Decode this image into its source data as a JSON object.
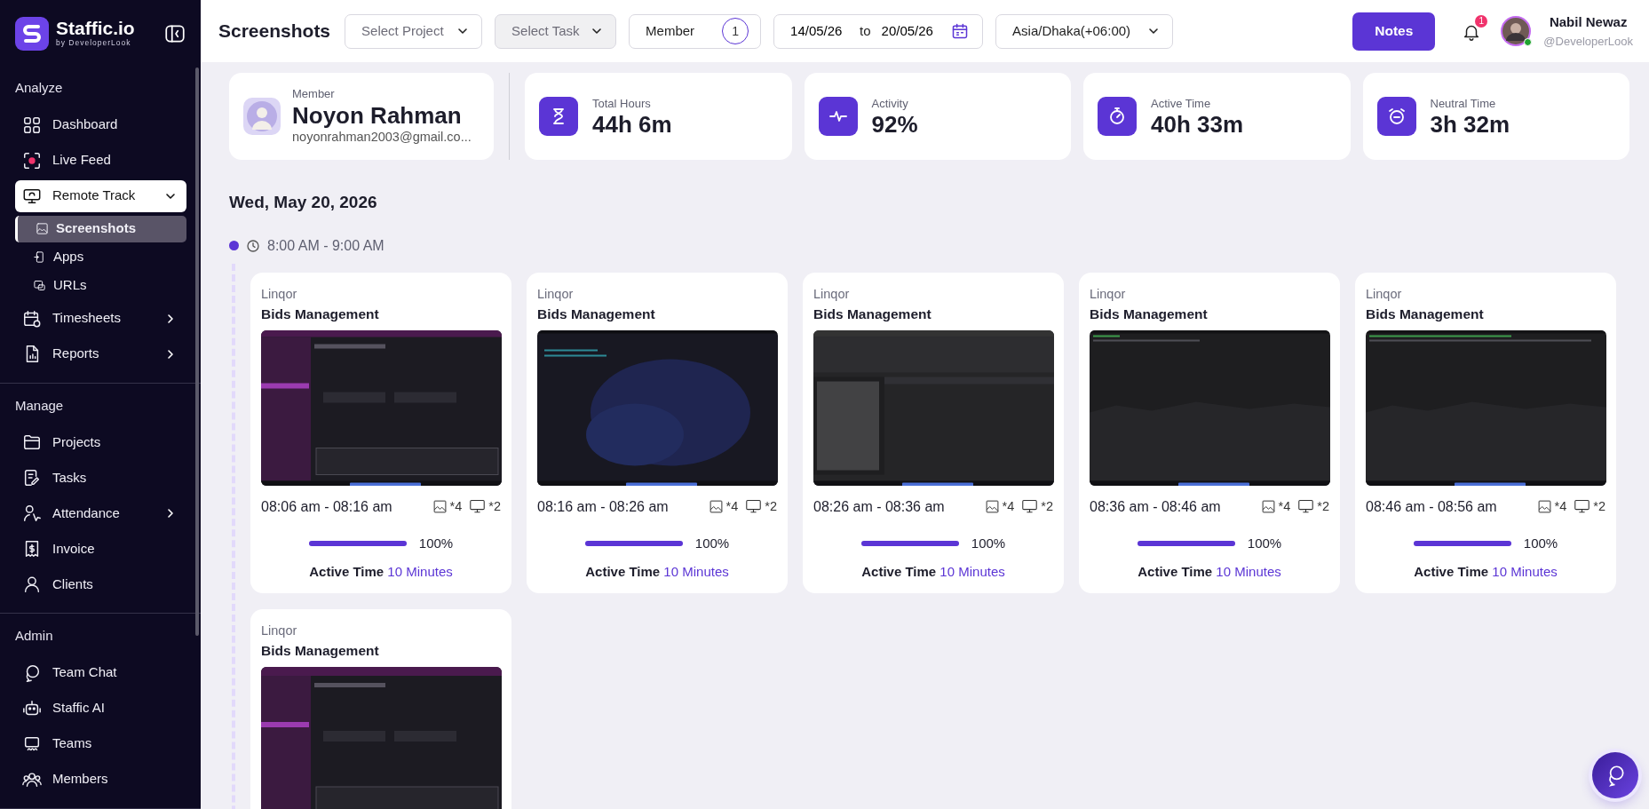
{
  "sidebar": {
    "brand": "Staffic.io",
    "brand_sub": "by DeveloperLook",
    "sections": [
      {
        "title": "Analyze",
        "items": [
          {
            "label": "Dashboard",
            "selected": false
          },
          {
            "label": "Live Feed",
            "selected": false
          },
          {
            "label": "Remote Track",
            "selected": true,
            "expanded": true,
            "children": [
              {
                "label": "Screenshots",
                "selected": true
              },
              {
                "label": "Apps",
                "selected": false
              },
              {
                "label": "URLs",
                "selected": false
              }
            ]
          },
          {
            "label": "Timesheets",
            "selected": false,
            "expanded": false
          },
          {
            "label": "Reports",
            "selected": false,
            "expanded": false
          }
        ]
      },
      {
        "title": "Manage",
        "items": [
          {
            "label": "Projects",
            "selected": false
          },
          {
            "label": "Tasks",
            "selected": false
          },
          {
            "label": "Attendance",
            "selected": false,
            "expanded": false
          },
          {
            "label": "Invoice",
            "selected": false
          },
          {
            "label": "Clients",
            "selected": false
          }
        ]
      },
      {
        "title": "Admin",
        "items": [
          {
            "label": "Team Chat",
            "selected": false
          },
          {
            "label": "Staffic AI",
            "selected": false
          },
          {
            "label": "Teams",
            "selected": false
          },
          {
            "label": "Members",
            "selected": false
          }
        ]
      }
    ]
  },
  "topbar": {
    "title": "Screenshots",
    "project_select": {
      "placeholder": "Select Project",
      "disabled": false
    },
    "task_select": {
      "placeholder": "Select Task",
      "disabled": true
    },
    "member_filter": {
      "label": "Member",
      "count": "1"
    },
    "date_range": {
      "from": "14/05/26",
      "separator": "to",
      "to": "20/05/26"
    },
    "timezone": "Asia/Dhaka(+06:00)",
    "notes_button": "Notes",
    "notifications": "1",
    "user": {
      "name": "Nabil Newaz",
      "handle": "@DeveloperLook",
      "online": true
    }
  },
  "member": {
    "label": "Member",
    "name": "Noyon Rahman",
    "email": "noyonrahman2003@gmail.co..."
  },
  "stats": [
    {
      "label": "Total Hours",
      "value": "44h 6m"
    },
    {
      "label": "Activity",
      "value": "92%"
    },
    {
      "label": "Active Time",
      "value": "40h 33m"
    },
    {
      "label": "Neutral Time",
      "value": "3h 32m"
    }
  ],
  "day": {
    "date": "Wed, May 20, 2026",
    "slot": "8:00 AM - 9:00 AM",
    "screenshots": [
      {
        "project": "Linqor",
        "task": "Bids Management",
        "time": "08:06 am - 08:16 am",
        "images": "*4",
        "screens": "*2",
        "level": 1,
        "percent": "100%",
        "active_label": "Active Time",
        "active_value": "10 Minutes"
      },
      {
        "project": "Linqor",
        "task": "Bids Management",
        "time": "08:16 am - 08:26 am",
        "images": "*4",
        "screens": "*2",
        "level": 1,
        "percent": "100%",
        "active_label": "Active Time",
        "active_value": "10 Minutes"
      },
      {
        "project": "Linqor",
        "task": "Bids Management",
        "time": "08:26 am - 08:36 am",
        "images": "*4",
        "screens": "*2",
        "level": 1,
        "percent": "100%",
        "active_label": "Active Time",
        "active_value": "10 Minutes"
      },
      {
        "project": "Linqor",
        "task": "Bids Management",
        "time": "08:36 am - 08:46 am",
        "images": "*4",
        "screens": "*2",
        "level": 1,
        "percent": "100%",
        "active_label": "Active Time",
        "active_value": "10 Minutes"
      },
      {
        "project": "Linqor",
        "task": "Bids Management",
        "time": "08:46 am - 08:56 am",
        "images": "*4",
        "screens": "*2",
        "level": 1,
        "percent": "100%",
        "active_label": "Active Time",
        "active_value": "10 Minutes"
      },
      {
        "project": "Linqor",
        "task": "Bids Management"
      }
    ]
  }
}
